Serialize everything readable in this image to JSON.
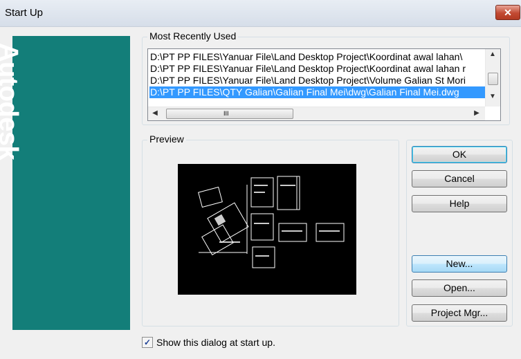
{
  "window": {
    "title": "Start Up",
    "close_label": "✕"
  },
  "brand": {
    "text": "Autodesk"
  },
  "mru": {
    "label": "Most Recently Used",
    "items": [
      "D:\\PT PP FILES\\Yanuar File\\Land Desktop Project\\Koordinat awal lahan\\",
      "D:\\PT PP FILES\\Yanuar File\\Land Desktop Project\\Koordinat awal lahan r",
      "D:\\PT PP FILES\\Yanuar File\\Land Desktop Project\\Volume Galian St Mori",
      "D:\\PT PP FILES\\QTY Galian\\Galian Final Mei\\dwg\\Galian Final Mei.dwg"
    ],
    "selected_index": 3,
    "hscroll_thumb_glyph": "III"
  },
  "preview": {
    "label": "Preview"
  },
  "buttons": {
    "ok": "OK",
    "cancel": "Cancel",
    "help": "Help",
    "new": "New...",
    "open": "Open...",
    "project_mgr": "Project Mgr..."
  },
  "startup_checkbox": {
    "label": "Show this dialog at start up.",
    "checked": true,
    "check_glyph": "✓"
  },
  "colors": {
    "brand": "#137e79",
    "selection": "#3399ff",
    "close": "#c24a33"
  }
}
